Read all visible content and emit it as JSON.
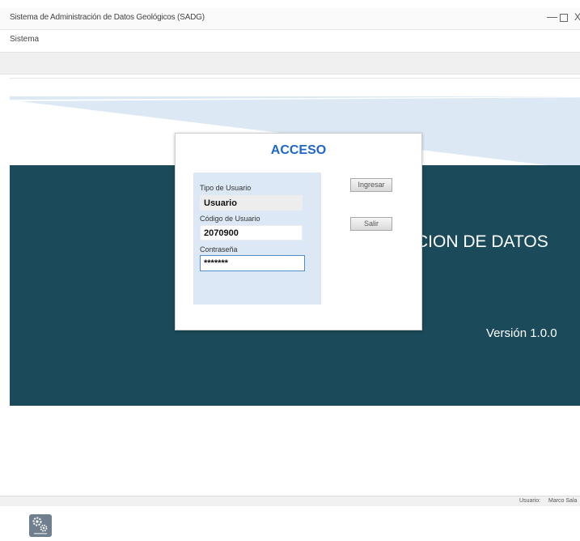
{
  "window": {
    "title": "Sistema de Administración de Datos Geológicos (SADG)",
    "controls": {
      "minimize": "—",
      "close": "X"
    }
  },
  "menu": {
    "items": [
      {
        "label": "Sistema"
      }
    ]
  },
  "banner": {
    "title": "ACION DE DATOS",
    "version": "Versión 1.0.0",
    "colors": {
      "dark": "#1b4b5a",
      "light": "#dce9f5"
    }
  },
  "login": {
    "title": "ACCESO",
    "fields": {
      "user_type": {
        "label": "Tipo de Usuario",
        "value": "Usuario"
      },
      "user_code": {
        "label": "Código de Usuario",
        "value": "2070900"
      },
      "password": {
        "label": "Contraseña",
        "value": "*******"
      }
    },
    "buttons": {
      "ingresar": "Ingresar",
      "salir": "Salir"
    },
    "colors": {
      "title": "#2066c8",
      "form_bg": "#dce8f5"
    }
  },
  "sidebar": {
    "config_icon": {
      "name": "configuration-gears-icon"
    }
  },
  "statusbar": {
    "user_label": "Usuario:",
    "user_value": "Marco Sala"
  }
}
